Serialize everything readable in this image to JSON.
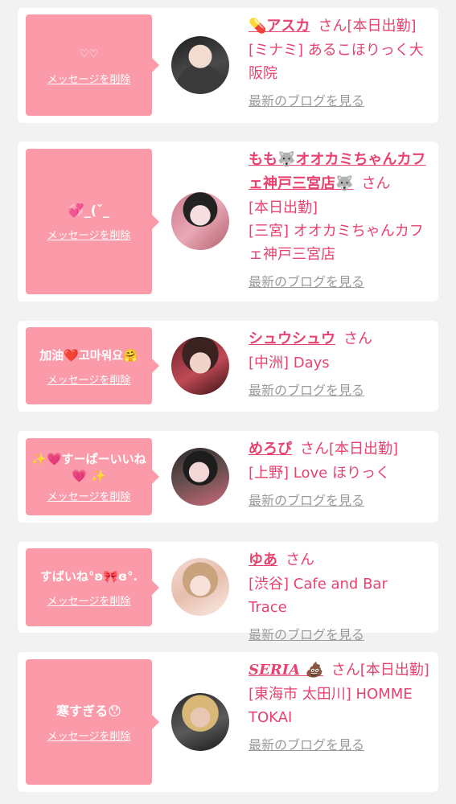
{
  "entries": [
    {
      "message": "♡♡",
      "delete_label": "メッセージを削除",
      "cast_name": "💊アスカ",
      "san": "さん[本日出勤]",
      "shop": "[ミナミ] あるこほりっく大阪院",
      "blog_label": "最新のブログを見る"
    },
    {
      "message": "💞_(ˇ_",
      "delete_label": "メッセージを削除",
      "cast_name": "もも🐺オオカミちゃんカフェ神戸三宮店🐺",
      "san": "さん",
      "status": "[本日出勤]",
      "shop": "[三宮] オオカミちゃんカフェ神戸三宮店",
      "blog_label": "最新のブログを見る"
    },
    {
      "message": "加油❤️고마워요🤗",
      "delete_label": "メッセージを削除",
      "cast_name": "シュウシュウ",
      "san": "さん",
      "shop": "[中洲] Days",
      "blog_label": "最新のブログを見る"
    },
    {
      "message": "✨💗すーぱーいいね💗 ✨",
      "delete_label": "メッセージを削除",
      "cast_name": "めろぴ",
      "san": "さん[本日出勤]",
      "shop": "[上野] Love ほりっく",
      "blog_label": "最新のブログを見る"
    },
    {
      "message": "すばいね°ʚ🎀ɞ°.",
      "delete_label": "メッセージを削除",
      "cast_name": "ゆあ",
      "san": "さん",
      "shop": "[渋谷] Cafe and Bar Trace",
      "blog_label": "最新のブログを見る"
    },
    {
      "message": "寒すぎる😯",
      "delete_label": "メッセージを削除",
      "cast_name": "SERIA 💩",
      "san": "さん[本日出勤]",
      "shop": "[東海市 太田川] HOMME TOKAI",
      "blog_label": "最新のブログを見る"
    }
  ],
  "colors": {
    "accent": "#e8426f",
    "bubble": "#fb9aa9",
    "muted": "#9a9a9a",
    "background": "#f2f2f2"
  }
}
